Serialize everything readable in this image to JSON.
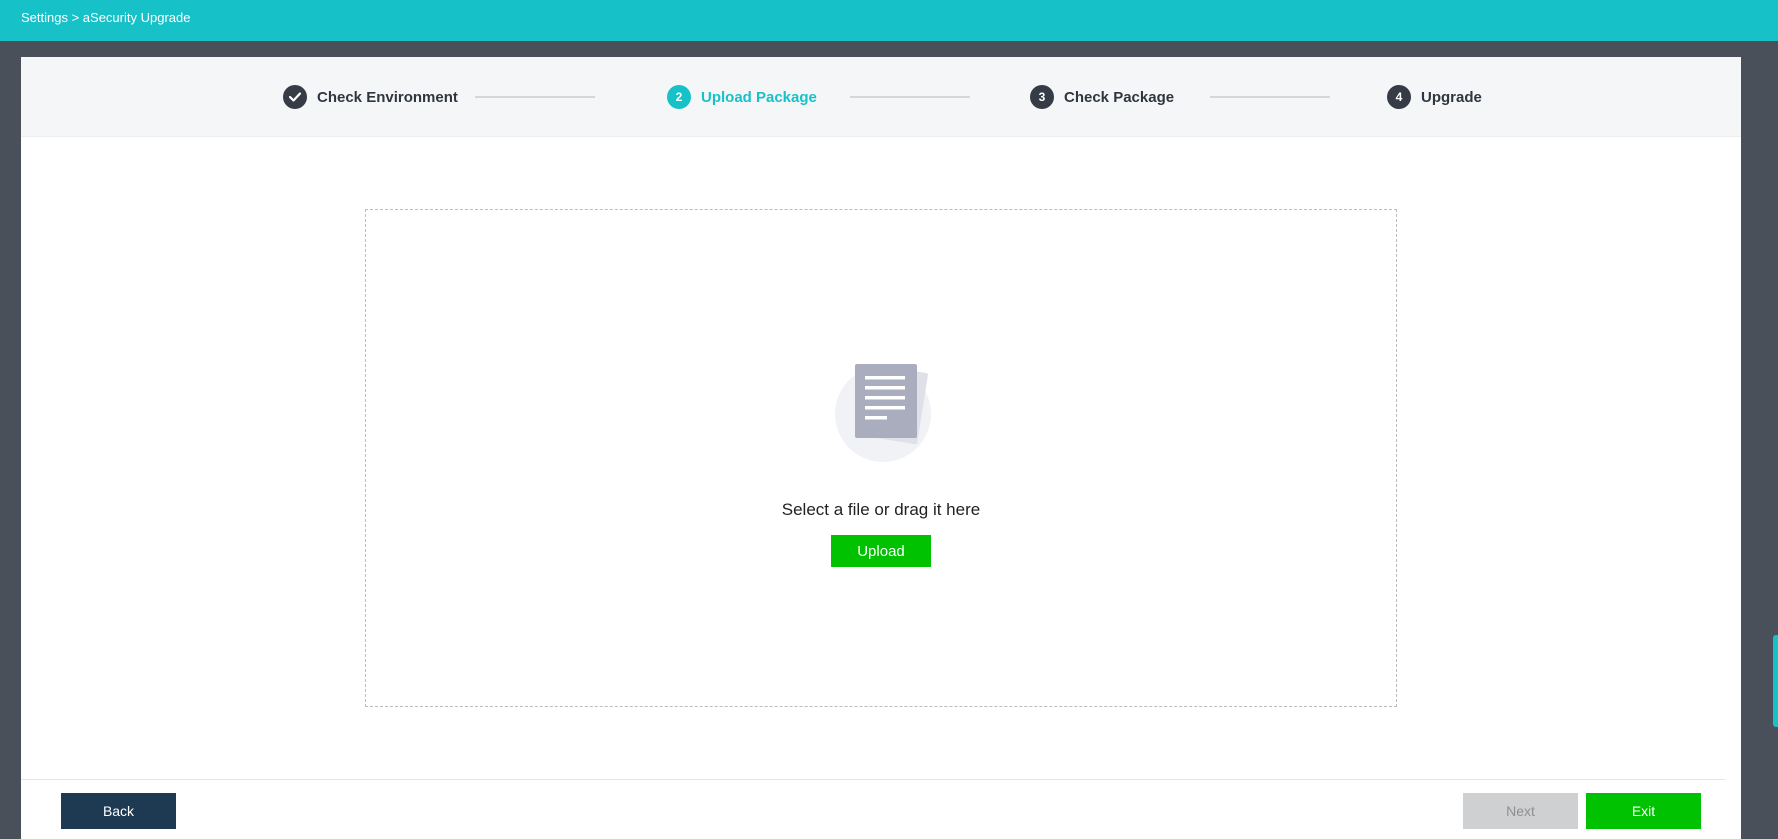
{
  "breadcrumb": "Settings > aSecurity Upgrade",
  "steps": [
    {
      "number": "",
      "label": "Check Environment",
      "state": "completed",
      "icon": "check-icon"
    },
    {
      "number": "2",
      "label": "Upload Package",
      "state": "active"
    },
    {
      "number": "3",
      "label": "Check Package",
      "state": "pending"
    },
    {
      "number": "4",
      "label": "Upgrade",
      "state": "pending"
    }
  ],
  "dropzone": {
    "icon": "document-icon",
    "text": "Select a file or drag it here",
    "upload_label": "Upload"
  },
  "footer": {
    "back_label": "Back",
    "next_label": "Next",
    "exit_label": "Exit"
  },
  "colors": {
    "accent": "#17c1c8",
    "primary_green": "#00c200",
    "dark_navy": "#1e3a52",
    "disabled": "#cfd0d2"
  }
}
